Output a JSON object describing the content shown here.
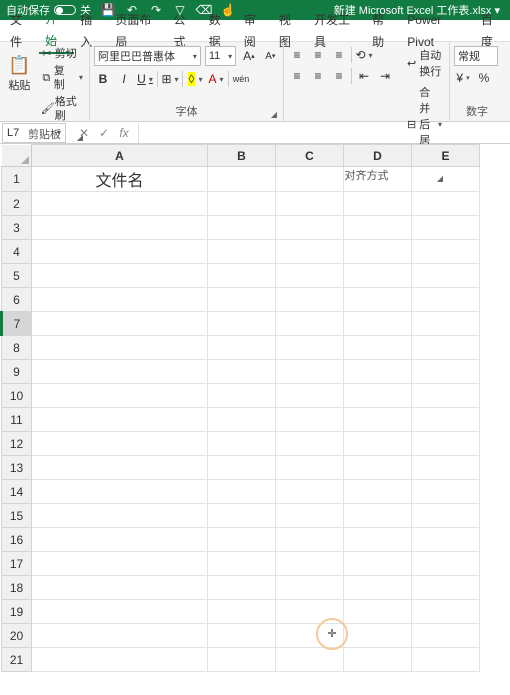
{
  "titlebar": {
    "autosave_label": "自动保存",
    "autosave_state": "关",
    "doc_title": "新建 Microsoft Excel 工作表.xlsx ▾",
    "qat_icons": [
      "save-icon",
      "undo-icon",
      "redo-icon",
      "filter-icon",
      "clear-filter-icon",
      "touch-icon"
    ]
  },
  "menubar": {
    "tabs": [
      "文件",
      "开始",
      "插入",
      "页面布局",
      "公式",
      "数据",
      "审阅",
      "视图",
      "开发工具",
      "帮助",
      "Power Pivot",
      "百度"
    ],
    "active_index": 1
  },
  "ribbon": {
    "clipboard": {
      "paste_label": "粘贴",
      "cut_label": "剪切",
      "copy_label": "复制",
      "format_painter_label": "格式刷",
      "group_label": "剪贴板"
    },
    "font": {
      "font_name": "阿里巴巴普惠体",
      "font_size": "11",
      "increase_tip": "A▴",
      "decrease_tip": "A▾",
      "bold": "B",
      "italic": "I",
      "underline": "U",
      "ruby": "wén",
      "group_label": "字体"
    },
    "alignment": {
      "wrap_text_label": "自动换行",
      "merge_center_label": "合并后居中",
      "group_label": "对齐方式"
    },
    "number": {
      "format": "常规",
      "group_label": "数字"
    }
  },
  "formula_bar": {
    "name_box": "L7",
    "formula": ""
  },
  "grid": {
    "columns": [
      "A",
      "B",
      "C",
      "D",
      "E"
    ],
    "row_count": 21,
    "active_row": 7,
    "cells": {
      "A1": "文件名"
    }
  },
  "cursor_glyph": "✛"
}
